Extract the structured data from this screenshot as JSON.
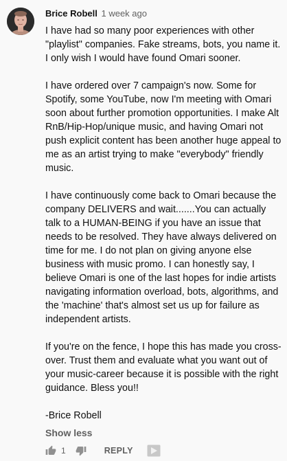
{
  "comment": {
    "author": "Brice Robell",
    "timestamp": "1 week ago",
    "paragraphs": [
      "I have had so many poor experiences with other \"playlist\" companies. Fake streams, bots, you name it. I only wish I would have found Omari sooner.",
      "I have ordered over 7 campaign's now. Some for Spotify, some YouTube, now I'm meeting with Omari soon about further promotion opportunities. I make Alt RnB/Hip-Hop/unique music, and having Omari not push explicit content has been another huge appeal to me as an artist trying to make \"everybody\" friendly music.",
      "I have continuously come back to Omari because the company DELIVERS and wait.......You can actually talk to a HUMAN-BEING if you have an issue that needs to be resolved. They have always delivered on time for me. I do not plan on giving anyone else business with music promo. I can honestly say, I believe Omari is one of the last hopes for indie artists navigating information overload, bots, algorithms, and the 'machine' that's almost set us up for failure as independent artists.",
      "If you're on the fence, I hope this has made you cross-over. Trust them and evaluate what you want out of your music-career because it is possible with the right guidance. Bless you!!",
      "-Brice Robell"
    ],
    "show_less_label": "Show less",
    "like_count": "1",
    "reply_label": "REPLY"
  },
  "icons": {
    "like": "thumbs-up-icon",
    "dislike": "thumbs-down-icon",
    "share": "share-arrow-icon"
  },
  "colors": {
    "background": "#f9f9f9",
    "text": "#111111",
    "secondary_text": "#606060",
    "icon": "#909090"
  }
}
